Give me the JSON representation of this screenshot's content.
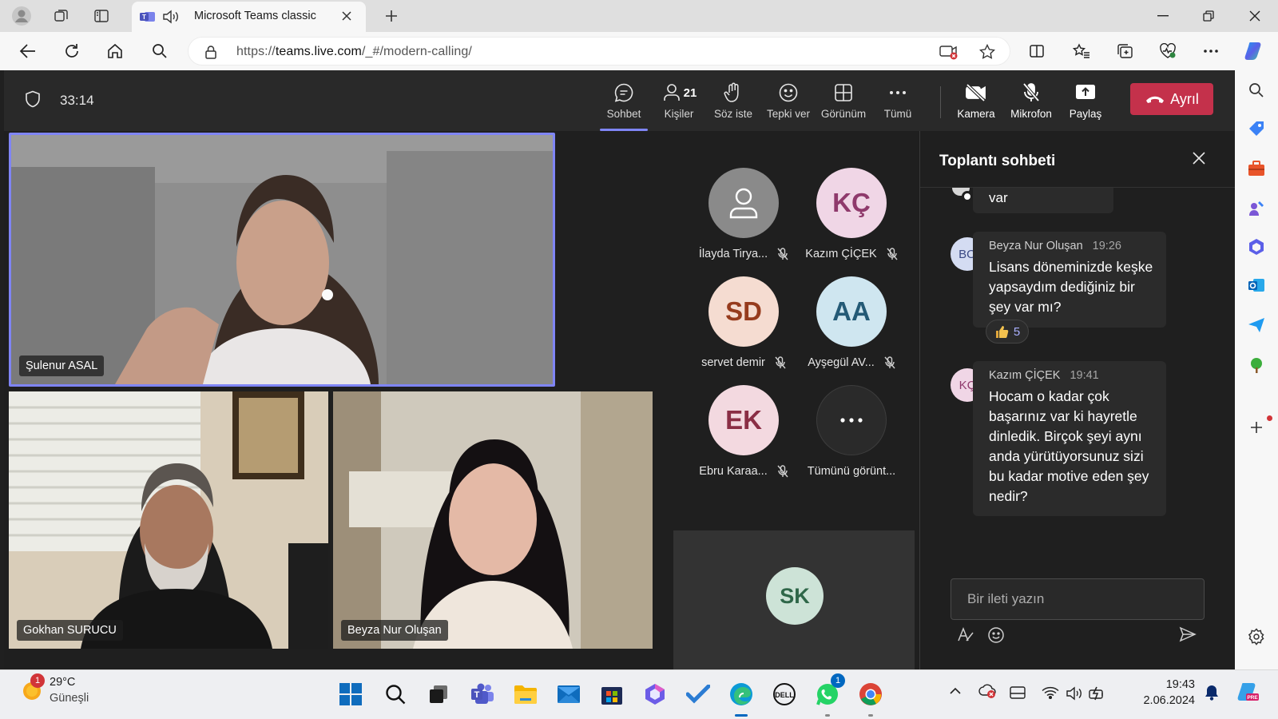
{
  "browser": {
    "tab_title": "Microsoft Teams classic",
    "url_prefix": "https://",
    "url_domain": "teams.live.com",
    "url_path": "/_#/modern-calling/"
  },
  "meeting": {
    "timer": "33:14",
    "toolbar": [
      {
        "id": "chat",
        "label": "Sohbet",
        "icon": "chat-icon",
        "active": true
      },
      {
        "id": "people",
        "label": "Kişiler",
        "icon": "people-icon",
        "count": "21"
      },
      {
        "id": "raise-hand",
        "label": "Söz iste",
        "icon": "hand-icon"
      },
      {
        "id": "react",
        "label": "Tepki ver",
        "icon": "smile-icon"
      },
      {
        "id": "view",
        "label": "Görünüm",
        "icon": "grid-icon"
      },
      {
        "id": "more",
        "label": "Tümü",
        "icon": "more-icon"
      },
      {
        "id": "camera",
        "label": "Kamera",
        "icon": "camera-off-icon"
      },
      {
        "id": "mic",
        "label": "Mikrofon",
        "icon": "mic-off-icon"
      },
      {
        "id": "share",
        "label": "Paylaş",
        "icon": "share-icon"
      }
    ],
    "leave_label": "Ayrıl",
    "videos": [
      {
        "name": "Şulenur ASAL",
        "speaking": true
      },
      {
        "name": "Gokhan SURUCU"
      },
      {
        "name": "Beyza Nur Oluşan"
      }
    ],
    "participants": [
      {
        "name": "İlayda Tirya...",
        "initials": "",
        "bg": "#8a8a8a",
        "fg": "#ffffff",
        "muted": true
      },
      {
        "name": "Kazım ÇİÇEK",
        "initials": "KÇ",
        "bg": "#f0d6e6",
        "fg": "#8f3a6c",
        "muted": true
      },
      {
        "name": "servet demir",
        "initials": "SD",
        "bg": "#f5dcd1",
        "fg": "#963b1d",
        "muted": true
      },
      {
        "name": "Ayşegül AV...",
        "initials": "AA",
        "bg": "#cfe6f0",
        "fg": "#245a76",
        "muted": true
      },
      {
        "name": "Ebru Karaa...",
        "initials": "EK",
        "bg": "#f3d9e0",
        "fg": "#8a2e45",
        "muted": true
      },
      {
        "name": "Tümünü görünt...",
        "initials": "...",
        "bg": "#2a2a2a",
        "fg": "#ffffff",
        "muted": false
      }
    ],
    "bottom_tile_initials": "SK"
  },
  "chat": {
    "title": "Toplantı sohbeti",
    "partial_text": "var",
    "messages": [
      {
        "initials": "BO",
        "avatar_bg": "#d4dcf2",
        "avatar_fg": "#3b4a84",
        "author": "Beyza Nur Oluşan",
        "time": "19:26",
        "text": "Lisans döneminizde keşke yapsaydım dediğiniz bir şey var mı?"
      },
      {
        "initials": "KÇ",
        "avatar_bg": "#f0d6e6",
        "avatar_fg": "#8f3a6c",
        "author": "Kazım ÇİÇEK",
        "time": "19:41",
        "text": "Hocam o kadar çok başarınız var ki hayretle dinledik. Birçok şeyi aynı anda yürütüyorsunuz sizi bu kadar motive eden şey nedir?"
      }
    ],
    "reaction": {
      "emoji": "👍",
      "count": "5"
    },
    "input_placeholder": "Bir ileti yazın"
  },
  "taskbar": {
    "weather_temp": "29°C",
    "weather_desc": "Güneşli",
    "weather_badge": "1",
    "whatsapp_badge": "1",
    "time": "19:43",
    "date": "2.06.2024"
  }
}
